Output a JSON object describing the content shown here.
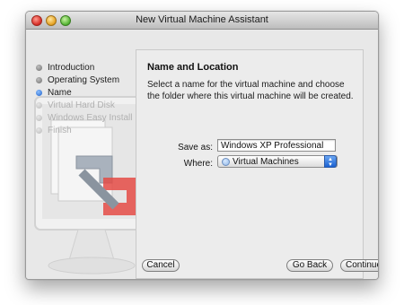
{
  "window": {
    "title": "New Virtual Machine Assistant"
  },
  "sidebar": {
    "steps": [
      {
        "label": "Introduction",
        "state": "done"
      },
      {
        "label": "Operating System",
        "state": "done"
      },
      {
        "label": "Name",
        "state": "current"
      },
      {
        "label": "Virtual Hard Disk",
        "state": "pending"
      },
      {
        "label": "Windows Easy Install",
        "state": "pending"
      },
      {
        "label": "Finish",
        "state": "pending"
      }
    ]
  },
  "main": {
    "heading": "Name and Location",
    "description": "Select a name for the virtual machine and choose the folder where this virtual machine will be created.",
    "save_as_label": "Save as:",
    "save_as_value": "Windows XP Professional",
    "where_label": "Where:",
    "where_value": "Virtual Machines"
  },
  "buttons": {
    "cancel": "Cancel",
    "go_back": "Go Back",
    "continue": "Continue"
  },
  "icons": {
    "watermark": "vmware-fusion-logo",
    "folder": "folder-icon",
    "popup_arrows": "updown-arrows-icon"
  },
  "colors": {
    "current_step": "#1c5fc9",
    "popup_accent": "#1b62d1",
    "logo_red": "#e44b45"
  }
}
